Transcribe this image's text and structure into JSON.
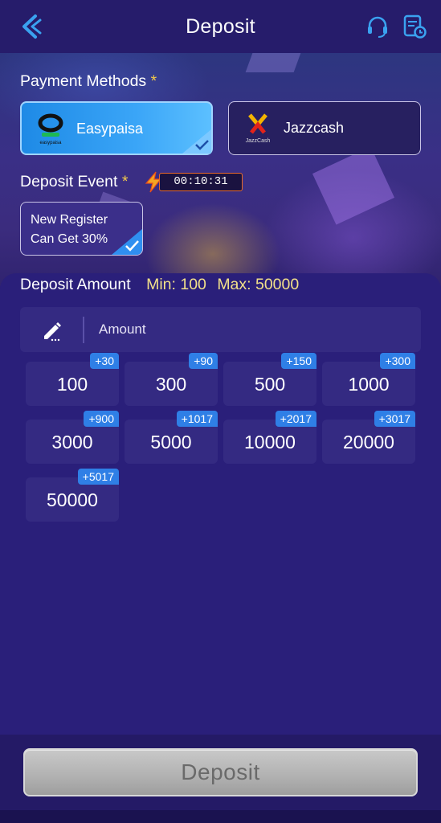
{
  "header": {
    "title": "Deposit",
    "back_icon": "back-arrow-icon",
    "support_icon": "headset-icon",
    "history_icon": "record-history-icon"
  },
  "payment_methods": {
    "label": "Payment Methods",
    "required_mark": "*",
    "options": [
      {
        "name": "Easypaisa",
        "logo_caption": "easypaisa",
        "selected": true
      },
      {
        "name": "Jazzcash",
        "logo_caption": "JazzCash",
        "selected": false
      }
    ]
  },
  "deposit_event": {
    "label": "Deposit Event",
    "required_mark": "*",
    "timer": "00:10:31",
    "card_line1": "New Register",
    "card_line2": "Can Get 30%",
    "selected": true
  },
  "deposit_amount": {
    "label": "Deposit Amount",
    "min_text": "Min: 100",
    "max_text": "Max: 50000",
    "input_placeholder": "Amount",
    "presets": [
      {
        "amount": "100",
        "bonus": "+30"
      },
      {
        "amount": "300",
        "bonus": "+90"
      },
      {
        "amount": "500",
        "bonus": "+150"
      },
      {
        "amount": "1000",
        "bonus": "+300"
      },
      {
        "amount": "3000",
        "bonus": "+900"
      },
      {
        "amount": "5000",
        "bonus": "+1017"
      },
      {
        "amount": "10000",
        "bonus": "+2017"
      },
      {
        "amount": "20000",
        "bonus": "+3017"
      },
      {
        "amount": "50000",
        "bonus": "+5017"
      }
    ]
  },
  "footer": {
    "deposit_button": "Deposit"
  },
  "colors": {
    "background": "#2a1f7a",
    "header": "#261c6b",
    "accent_blue": "#2f7fe6",
    "star": "#f2c94c",
    "range_text": "#f2e08a",
    "timer_border": "#e86a2a",
    "button_disabled": "#b3b3b3"
  }
}
